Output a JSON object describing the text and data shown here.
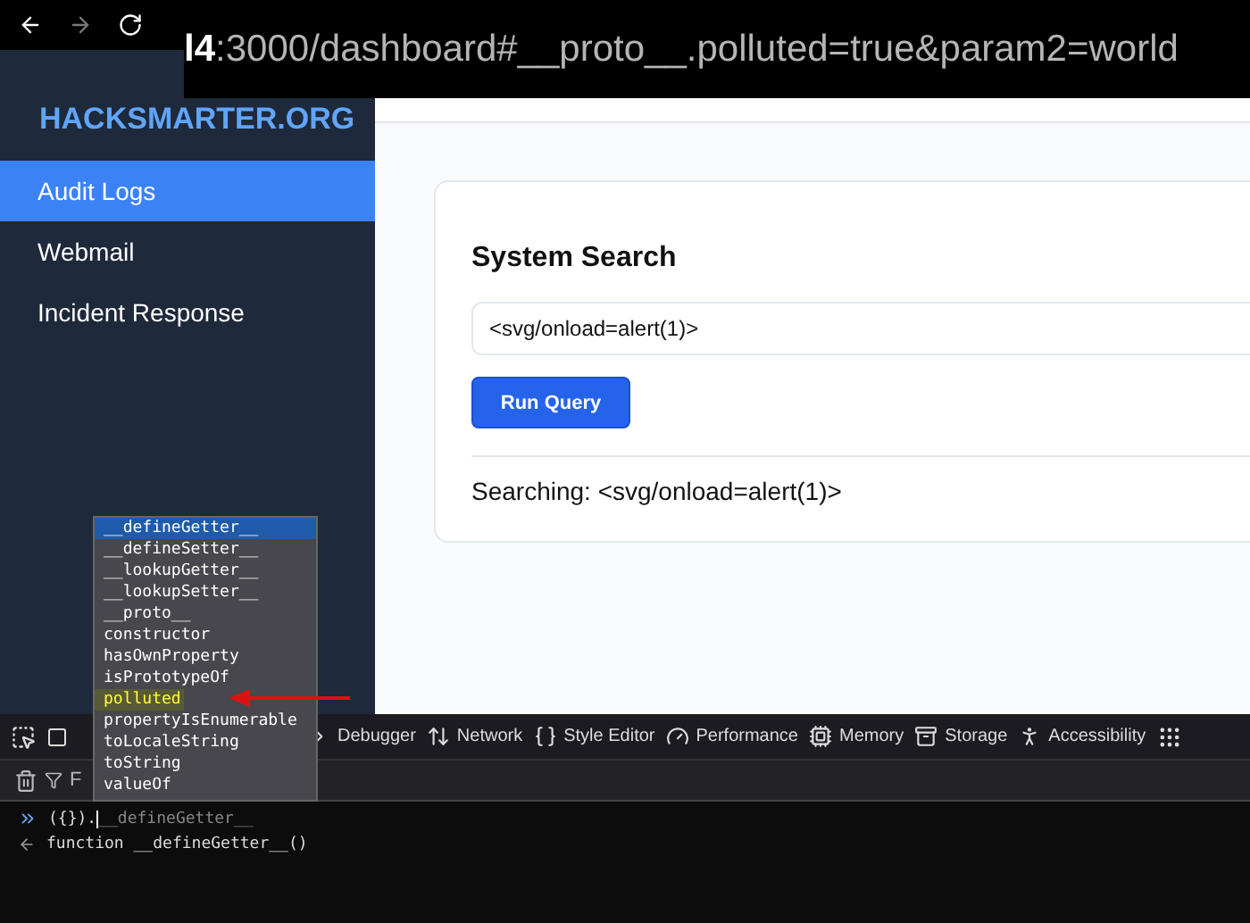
{
  "browser": {
    "url_start": "l4",
    "url_rest": ":3000/dashboard#__proto__.polluted=true&param2=world"
  },
  "sidebar": {
    "logo": "HACKSMARTER.ORG",
    "items": [
      {
        "label": "Audit Logs",
        "selected": true
      },
      {
        "label": "Webmail",
        "selected": false
      },
      {
        "label": "Incident Response",
        "selected": false
      }
    ]
  },
  "search_card": {
    "title": "System Search",
    "input_value": "<svg/onload=alert(1)>",
    "button": "Run Query",
    "result": "Searching: <svg/onload=alert(1)>"
  },
  "devtools": {
    "tabs": [
      {
        "kind": "debugger",
        "label": "Debugger"
      },
      {
        "kind": "network",
        "label": "Network"
      },
      {
        "kind": "style",
        "label": "Style Editor"
      },
      {
        "kind": "performance",
        "label": "Performance"
      },
      {
        "kind": "memory",
        "label": "Memory"
      },
      {
        "kind": "storage",
        "label": "Storage"
      },
      {
        "kind": "accessibility",
        "label": "Accessibility"
      }
    ],
    "filter_partial": "F",
    "console": {
      "input_typed": "({}).",
      "input_hint": "__defineGetter__",
      "output": "function __defineGetter__()"
    },
    "autocomplete": [
      {
        "label": "__defineGetter__",
        "selected": true,
        "highlighted": false
      },
      {
        "label": "__defineSetter__",
        "selected": false,
        "highlighted": false
      },
      {
        "label": "__lookupGetter__",
        "selected": false,
        "highlighted": false
      },
      {
        "label": "__lookupSetter__",
        "selected": false,
        "highlighted": false
      },
      {
        "label": "__proto__",
        "selected": false,
        "highlighted": false
      },
      {
        "label": "constructor",
        "selected": false,
        "highlighted": false
      },
      {
        "label": "hasOwnProperty",
        "selected": false,
        "highlighted": false
      },
      {
        "label": "isPrototypeOf",
        "selected": false,
        "highlighted": false
      },
      {
        "label": "polluted",
        "selected": false,
        "highlighted": true
      },
      {
        "label": "propertyIsEnumerable",
        "selected": false,
        "highlighted": false
      },
      {
        "label": "toLocaleString",
        "selected": false,
        "highlighted": false
      },
      {
        "label": "toString",
        "selected": false,
        "highlighted": false
      },
      {
        "label": "valueOf",
        "selected": false,
        "highlighted": false
      }
    ]
  }
}
